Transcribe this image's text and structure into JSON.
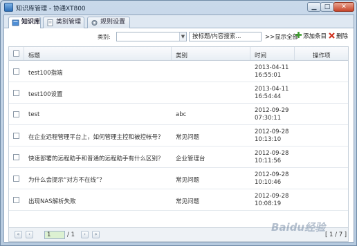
{
  "window": {
    "title": "知识库管理 - 协通XT800",
    "min_label": "▁",
    "max_label": "□",
    "close_label": "✕"
  },
  "tabs": [
    {
      "label": "知识库"
    },
    {
      "label": "类别管理"
    },
    {
      "label": "规则设置"
    }
  ],
  "toolbar": {
    "category_label": "类别:",
    "search_placeholder": "按标题/内容搜索...",
    "show_all": ">>显示全部",
    "add_label": "添加条目",
    "delete_label": "删除"
  },
  "table": {
    "headers": [
      "标题",
      "类别",
      "时间",
      "操作项"
    ],
    "rows": [
      {
        "title": "test100指端",
        "category": "",
        "date": "2013-04-11",
        "time": "16:55:01"
      },
      {
        "title": "test100设置",
        "category": "",
        "date": "2013-04-11",
        "time": "16:54:44"
      },
      {
        "title": "test",
        "category": "abc",
        "date": "2012-09-29",
        "time": "07:30:11"
      },
      {
        "title": "在企业远程管理平台上，如何管理主控和被控帐号？",
        "category": "常见问题",
        "date": "2012-09-28",
        "time": "10:13:10"
      },
      {
        "title": "快速部署的远程助手和普通的远程助手有什么区别？",
        "category": "企业管理台",
        "date": "2012-09-28",
        "time": "10:11:56"
      },
      {
        "title": "为什么会提示“对方不在线”？",
        "category": "常见问题",
        "date": "2012-09-28",
        "time": "10:10:46"
      },
      {
        "title": "出现NAS解析失败",
        "category": "常见问题",
        "date": "2012-09-28",
        "time": "10:08:19"
      }
    ]
  },
  "pager": {
    "current_page": "1",
    "total_pages": "/ 1",
    "info": "[ 1 / 7 ]"
  },
  "watermark": "Baidu经验"
}
